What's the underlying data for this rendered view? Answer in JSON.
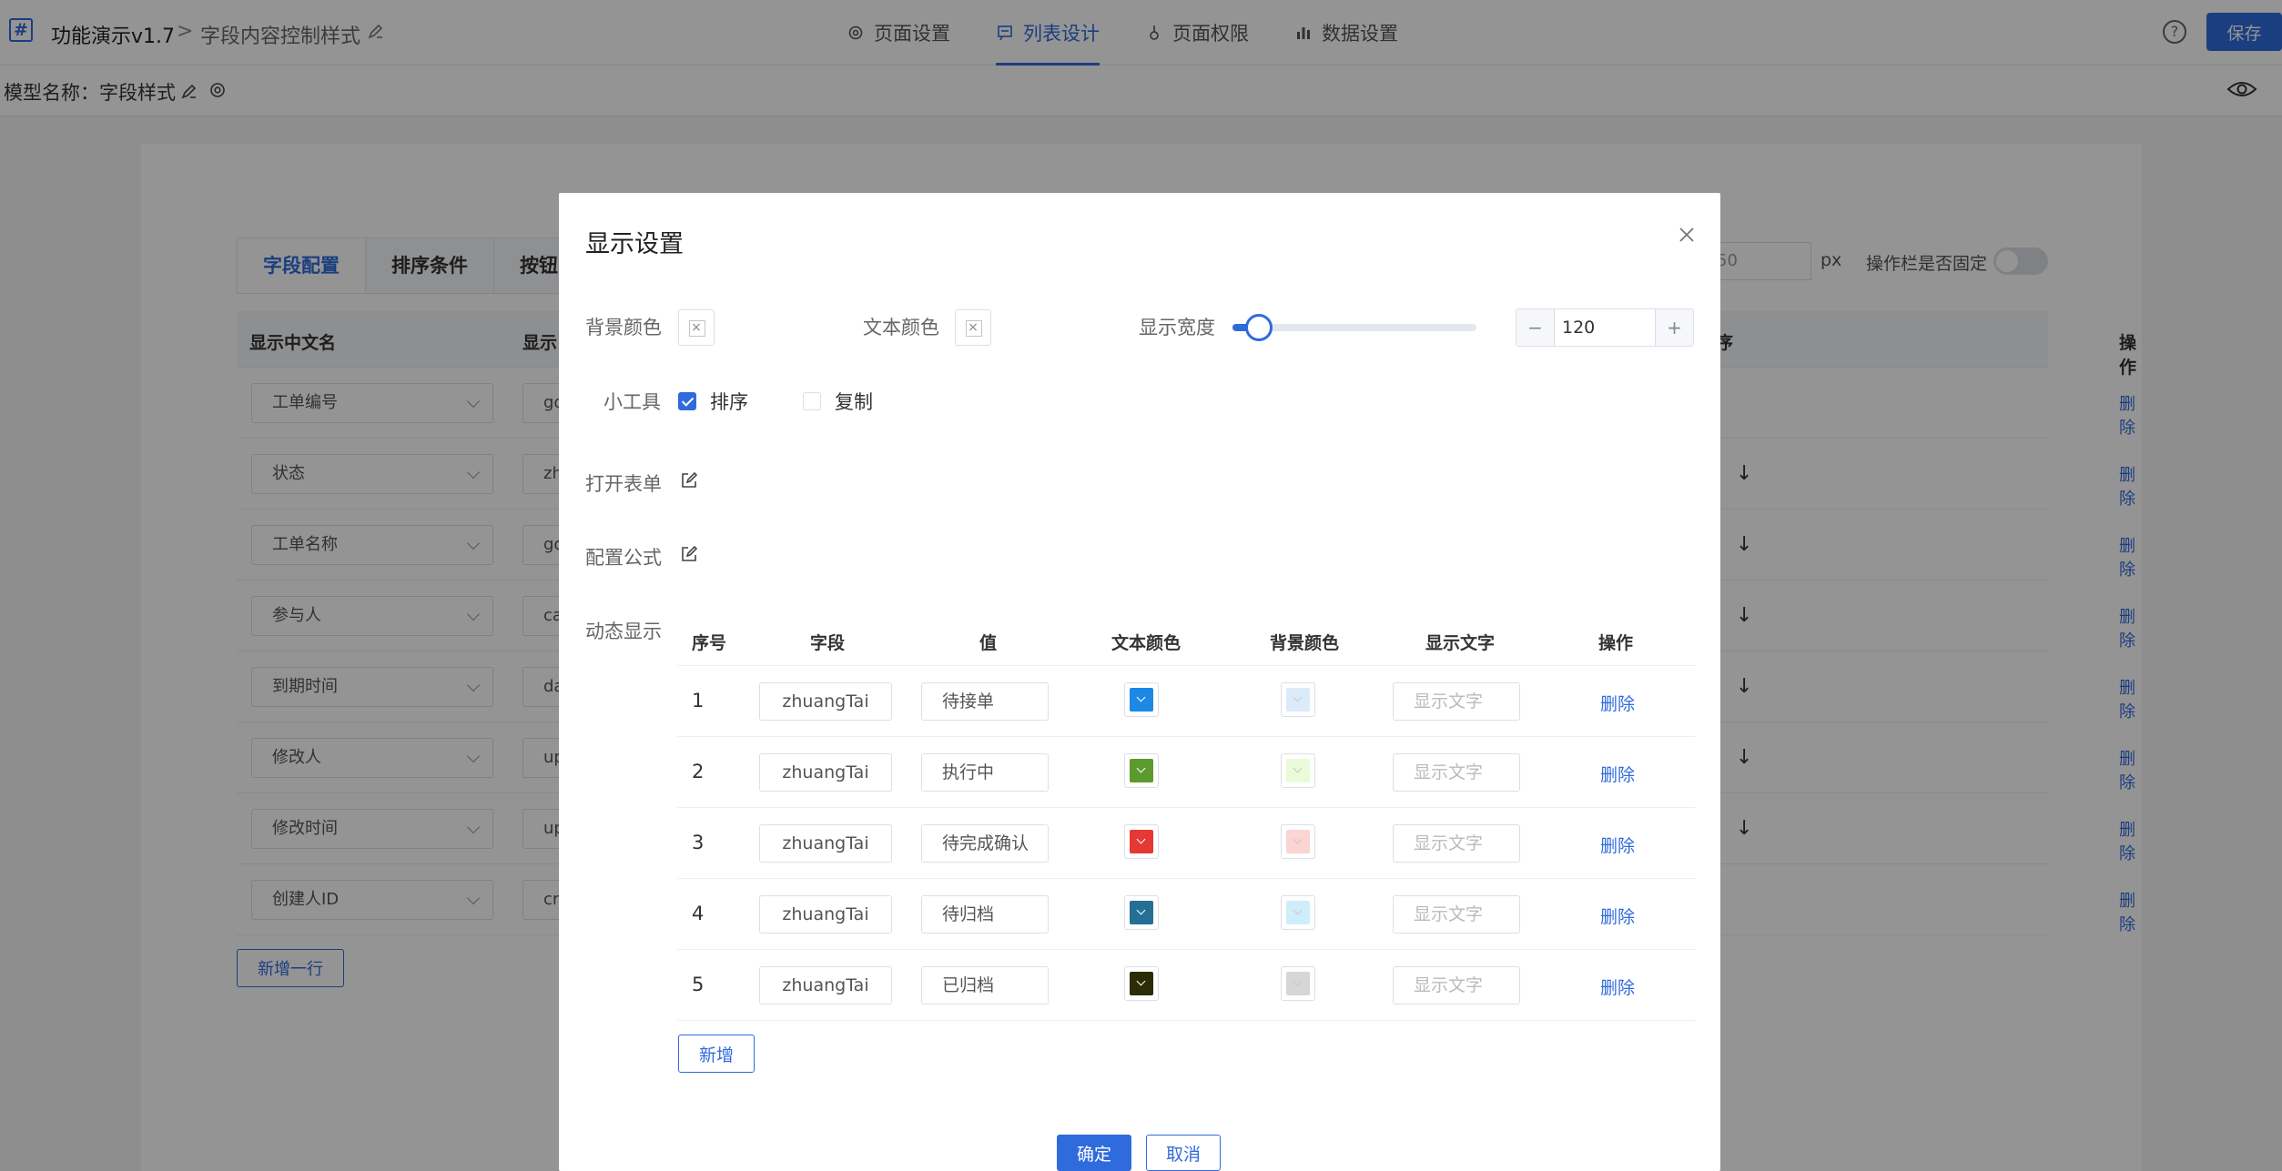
{
  "topbar": {
    "logo_glyph": "#",
    "app_title": "功能演示v1.7",
    "crumb_sep": ">",
    "page_name": "字段内容控制样式",
    "tabs": [
      {
        "label": "页面设置",
        "icon": "gear-icon"
      },
      {
        "label": "列表设计",
        "icon": "list-design-icon"
      },
      {
        "label": "页面权限",
        "icon": "permission-icon"
      },
      {
        "label": "数据设置",
        "icon": "bar-chart-icon"
      }
    ],
    "active_tab": "列表设计",
    "help_glyph": "?",
    "save_label": "保存"
  },
  "subbar": {
    "model_name": "模型名称：字段样式"
  },
  "background": {
    "config_tabs": [
      "字段配置",
      "排序条件",
      "按钮"
    ],
    "width_value": "50",
    "px_label": "px",
    "fixed_label": "操作栏是否固定",
    "table_headers": [
      "显示中文名",
      "显示",
      "序",
      "操作"
    ],
    "rows": [
      {
        "name": "工单编号",
        "field": "go",
        "arrow": "",
        "action": "删除"
      },
      {
        "name": "状态",
        "field": "zh",
        "arrow": "↓",
        "action": "删除"
      },
      {
        "name": "工单名称",
        "field": "go",
        "arrow": "↓",
        "action": "删除"
      },
      {
        "name": "参与人",
        "field": "ca",
        "arrow": "↓",
        "action": "删除"
      },
      {
        "name": "到期时间",
        "field": "da",
        "arrow": "↓",
        "action": "删除"
      },
      {
        "name": "修改人",
        "field": "up",
        "arrow": "↓",
        "action": "删除"
      },
      {
        "name": "修改时间",
        "field": "up",
        "arrow": "↓",
        "action": "删除"
      },
      {
        "name": "创建人ID",
        "field": "cr",
        "arrow": "",
        "action": "删除"
      }
    ],
    "add_row_label": "新增一行"
  },
  "modal": {
    "title": "显示设置",
    "close_glyph": "✕",
    "bg_color_label": "背景颜色",
    "text_color_label": "文本颜色",
    "clear_glyph": "×",
    "width_label": "显示宽度",
    "width_slider_fraction": 0.07,
    "width_value": "120",
    "minus_glyph": "−",
    "plus_glyph": "+",
    "tools_label": "小工具",
    "tool_sort": {
      "label": "排序",
      "checked": true
    },
    "tool_copy": {
      "label": "复制",
      "checked": false
    },
    "open_form_label": "打开表单",
    "formula_label": "配置公式",
    "dynamic_label": "动态显示",
    "dyn_headers": [
      "序号",
      "字段",
      "值",
      "文本颜色",
      "背景颜色",
      "显示文字",
      "操作"
    ],
    "dyn_rows": [
      {
        "idx": "1",
        "field": "zhuangTai",
        "value": "待接单",
        "text_color": "#1e88e5",
        "bg_color": "#dcebfa",
        "text_placeholder": "显示文字",
        "action": "删除"
      },
      {
        "idx": "2",
        "field": "zhuangTai",
        "value": "执行中",
        "text_color": "#5c9a2e",
        "bg_color": "#eafbd9",
        "text_placeholder": "显示文字",
        "action": "删除"
      },
      {
        "idx": "3",
        "field": "zhuangTai",
        "value": "待完成确认",
        "text_color": "#e53935",
        "bg_color": "#fbd4d4",
        "text_placeholder": "显示文字",
        "action": "删除"
      },
      {
        "idx": "4",
        "field": "zhuangTai",
        "value": "待归档",
        "text_color": "#256f96",
        "bg_color": "#cfeefb",
        "text_placeholder": "显示文字",
        "action": "删除"
      },
      {
        "idx": "5",
        "field": "zhuangTai",
        "value": "已归档",
        "text_color": "#2b2b08",
        "bg_color": "#d6d6d6",
        "text_placeholder": "显示文字",
        "action": "删除"
      }
    ],
    "add_label": "新增",
    "ok_label": "确定",
    "cancel_label": "取消"
  },
  "colors": {
    "accent": "#2f6bdd"
  }
}
